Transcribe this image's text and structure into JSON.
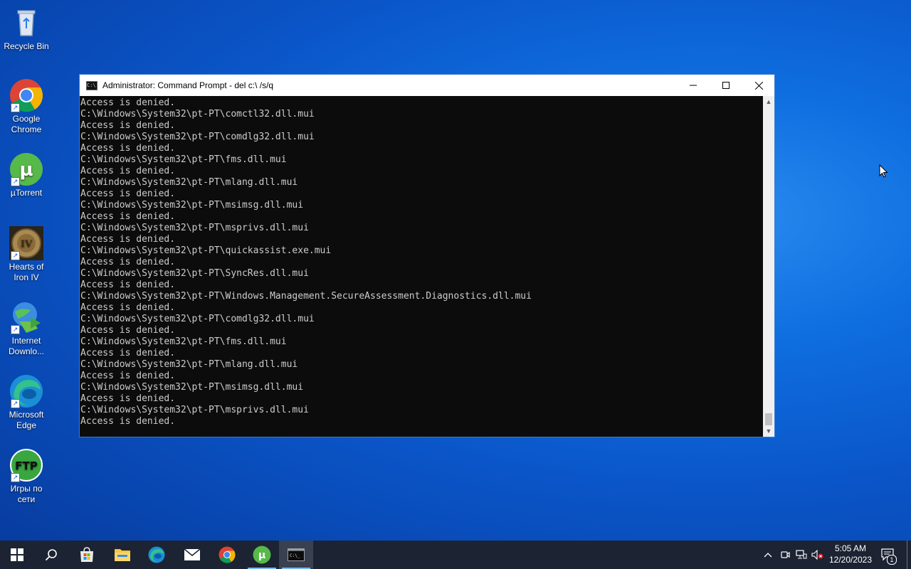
{
  "desktop": {
    "icons": [
      {
        "label": "Recycle Bin",
        "icon": "recycle-bin-icon"
      },
      {
        "label": "Google Chrome",
        "icon": "chrome-icon"
      },
      {
        "label": "µTorrent",
        "icon": "utorrent-icon"
      },
      {
        "label": "Hearts of Iron IV",
        "icon": "hearts-of-iron-icon"
      },
      {
        "label": "Internet Downlo...",
        "icon": "internet-download-manager-icon"
      },
      {
        "label": "Microsoft Edge",
        "icon": "edge-icon"
      },
      {
        "label": "Игры по сети",
        "icon": "ftp-icon"
      }
    ]
  },
  "window": {
    "title": "Administrator: Command Prompt - del  c:\\ /s/q",
    "icon": "cmd-icon",
    "controls": {
      "minimize": "minimize-icon",
      "maximize": "maximize-icon",
      "close": "close-icon"
    }
  },
  "console": {
    "lines": [
      "Access is denied.",
      "C:\\Windows\\System32\\pt-PT\\comctl32.dll.mui",
      "Access is denied.",
      "C:\\Windows\\System32\\pt-PT\\comdlg32.dll.mui",
      "Access is denied.",
      "C:\\Windows\\System32\\pt-PT\\fms.dll.mui",
      "Access is denied.",
      "C:\\Windows\\System32\\pt-PT\\mlang.dll.mui",
      "Access is denied.",
      "C:\\Windows\\System32\\pt-PT\\msimsg.dll.mui",
      "Access is denied.",
      "C:\\Windows\\System32\\pt-PT\\msprivs.dll.mui",
      "Access is denied.",
      "C:\\Windows\\System32\\pt-PT\\quickassist.exe.mui",
      "Access is denied.",
      "C:\\Windows\\System32\\pt-PT\\SyncRes.dll.mui",
      "Access is denied.",
      "C:\\Windows\\System32\\pt-PT\\Windows.Management.SecureAssessment.Diagnostics.dll.mui",
      "Access is denied.",
      "C:\\Windows\\System32\\pt-PT\\comdlg32.dll.mui",
      "Access is denied.",
      "C:\\Windows\\System32\\pt-PT\\fms.dll.mui",
      "Access is denied.",
      "C:\\Windows\\System32\\pt-PT\\mlang.dll.mui",
      "Access is denied.",
      "C:\\Windows\\System32\\pt-PT\\msimsg.dll.mui",
      "Access is denied.",
      "C:\\Windows\\System32\\pt-PT\\msprivs.dll.mui",
      "Access is denied."
    ]
  },
  "taskbar": {
    "items": [
      {
        "icon": "start-icon"
      },
      {
        "icon": "search-icon"
      },
      {
        "icon": "microsoft-store-icon"
      },
      {
        "icon": "file-explorer-icon"
      },
      {
        "icon": "edge-icon"
      },
      {
        "icon": "mail-icon"
      },
      {
        "icon": "chrome-icon"
      },
      {
        "icon": "utorrent-icon"
      },
      {
        "icon": "command-prompt-icon",
        "active": true
      }
    ],
    "tray": {
      "icons": [
        "chevron-up-icon",
        "meet-now-icon",
        "network-icon",
        "volume-muted-icon"
      ],
      "time": "5:05 AM",
      "date": "12/20/2023",
      "notifications_count": "1"
    }
  },
  "colors": {
    "console_bg": "#0c0c0c",
    "console_text": "#cccccc",
    "taskbar_bg": "#1c2333",
    "active_underline": "#76b9ed"
  }
}
